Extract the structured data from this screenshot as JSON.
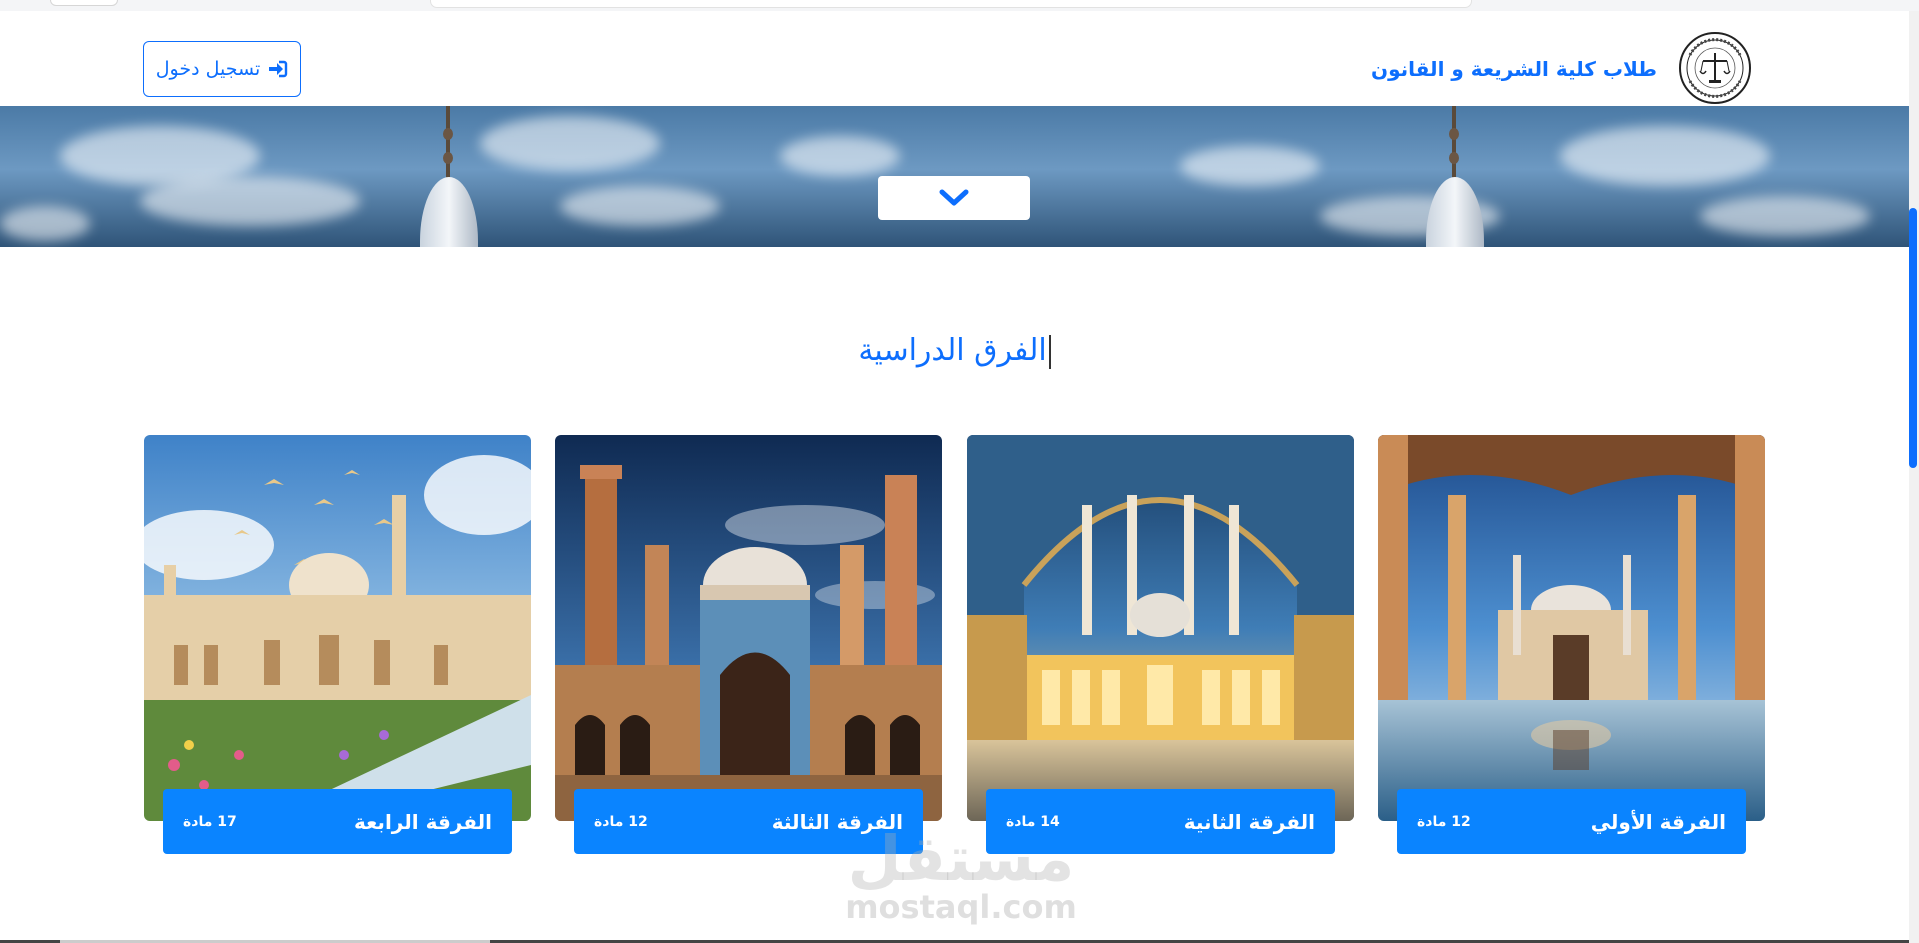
{
  "header": {
    "site_name": "طلاب كلية الشريعة و القانون",
    "login_label": "تسجيل دخول",
    "logo_icon": "university-seal-logo",
    "login_icon": "sign-in-icon"
  },
  "hero": {
    "scroll_icon": "chevron-down-icon"
  },
  "section": {
    "title": "الفرق الدراسية"
  },
  "cards": [
    {
      "title": "الفرقة الأولي",
      "count": "12 مادة"
    },
    {
      "title": "الفرقة الثانية",
      "count": "14 مادة"
    },
    {
      "title": "الفرقة الثالثة",
      "count": "12 مادة"
    },
    {
      "title": "الفرقة الرابعة",
      "count": "17 مادة"
    }
  ],
  "watermark": {
    "arabic": "مستقل",
    "latin": "mostaql.com"
  },
  "colors": {
    "primary": "#0d6efd",
    "card_label": "#0a84ff"
  }
}
